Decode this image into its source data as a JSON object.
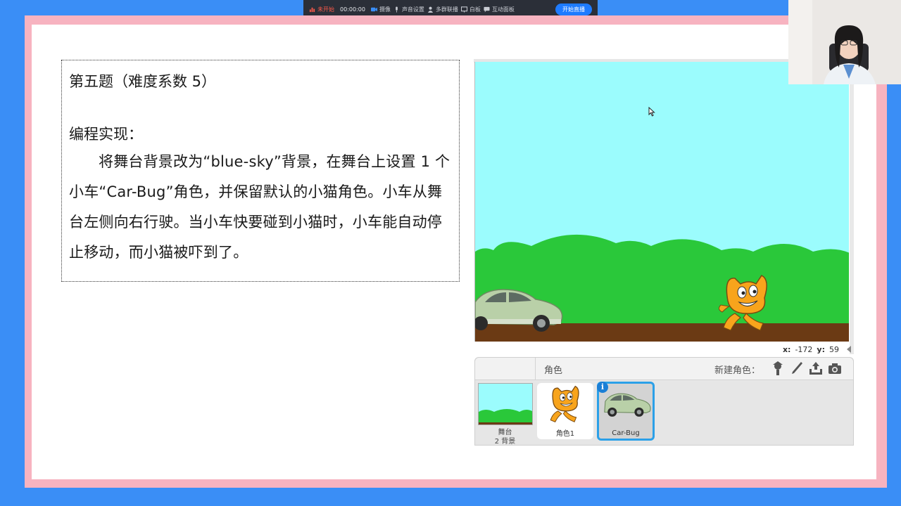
{
  "toolbar": {
    "record_label": "未开始",
    "timer": "00:00:00",
    "camera_label": "摄像",
    "audio_label": "声音设置",
    "multi_label": "多群联播",
    "whiteboard_label": "白板",
    "interactive_label": "互动面板",
    "live_button": "开始直播"
  },
  "question": {
    "title": "第五题（难度系数 5）",
    "subtitle": "编程实现：",
    "body": "将舞台背景改为“blue-sky”背景，在舞台上设置 1 个小车“Car-Bug”角色，并保留默认的小猫角色。小车从舞台左侧向右行驶。当小车快要碰到小猫时，小车能自动停止移动，而小猫被吓到了。"
  },
  "coords": {
    "x_label": "x:",
    "x_value": "-172",
    "y_label": "y:",
    "y_value": "59"
  },
  "sprite_panel": {
    "header_label": "角色",
    "new_sprite_label": "新建角色：",
    "stage_label": "舞台",
    "stage_backdrops": "2 背景",
    "sprites": [
      {
        "label": "角色1"
      },
      {
        "label": "Car-Bug",
        "selected": true
      }
    ],
    "info_glyph": "i"
  },
  "colors": {
    "sky": "#9bfcfd",
    "grass": "#2ac83a",
    "ground": "#6b3a14",
    "frame_blue": "#3a8ef6",
    "frame_pink": "#f7b3c0",
    "selected_border": "#2ba0e8"
  },
  "icons": [
    "record-icon",
    "camera-icon",
    "microphone-icon",
    "user-icon",
    "whiteboard-icon",
    "chat-icon",
    "sprite-library-icon",
    "paint-brush-icon",
    "upload-icon",
    "camera-capture-icon",
    "mouse-cursor-icon"
  ]
}
